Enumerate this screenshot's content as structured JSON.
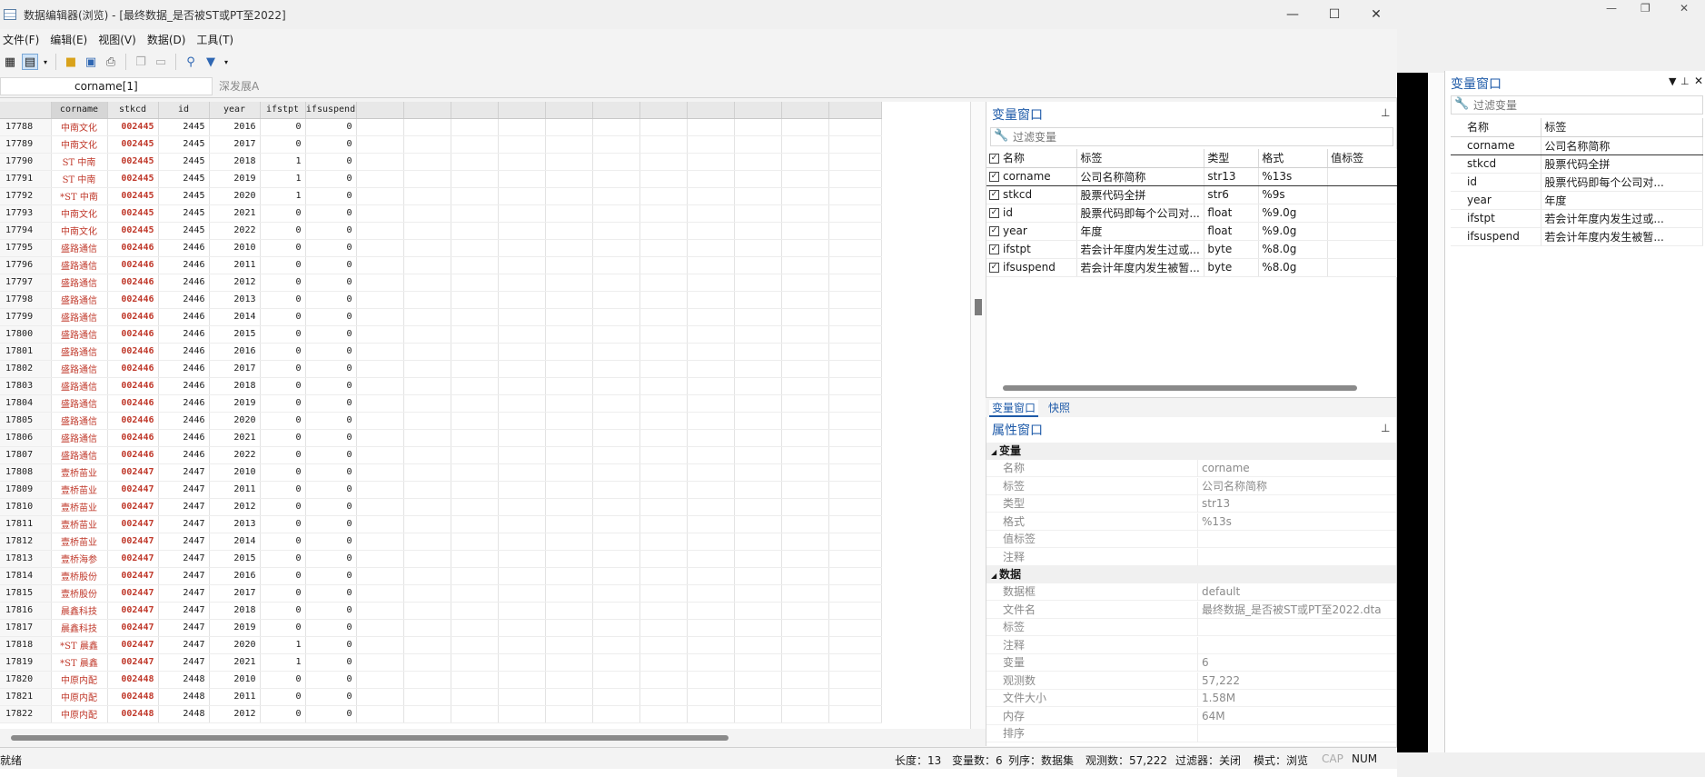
{
  "window": {
    "title": "数据编辑器(浏览) - [最终数据_是否被ST或PT至2022]",
    "minimize": "—",
    "maximize": "☐",
    "close": "✕"
  },
  "menu": [
    "文件(F)",
    "编辑(E)",
    "视图(V)",
    "数据(D)",
    "工具(T)"
  ],
  "cell_bar": {
    "reference": "corname[1]",
    "value": "深发展A"
  },
  "grid": {
    "columns": [
      "corname",
      "stkcd",
      "id",
      "year",
      "ifstpt",
      "ifsuspend"
    ],
    "rows": [
      [
        "17788",
        "中南文化",
        "002445",
        "2445",
        "2016",
        "0",
        "0"
      ],
      [
        "17789",
        "中南文化",
        "002445",
        "2445",
        "2017",
        "0",
        "0"
      ],
      [
        "17790",
        "ST 中南",
        "002445",
        "2445",
        "2018",
        "1",
        "0"
      ],
      [
        "17791",
        "ST 中南",
        "002445",
        "2445",
        "2019",
        "1",
        "0"
      ],
      [
        "17792",
        "*ST 中南",
        "002445",
        "2445",
        "2020",
        "1",
        "0"
      ],
      [
        "17793",
        "中南文化",
        "002445",
        "2445",
        "2021",
        "0",
        "0"
      ],
      [
        "17794",
        "中南文化",
        "002445",
        "2445",
        "2022",
        "0",
        "0"
      ],
      [
        "17795",
        "盛路通信",
        "002446",
        "2446",
        "2010",
        "0",
        "0"
      ],
      [
        "17796",
        "盛路通信",
        "002446",
        "2446",
        "2011",
        "0",
        "0"
      ],
      [
        "17797",
        "盛路通信",
        "002446",
        "2446",
        "2012",
        "0",
        "0"
      ],
      [
        "17798",
        "盛路通信",
        "002446",
        "2446",
        "2013",
        "0",
        "0"
      ],
      [
        "17799",
        "盛路通信",
        "002446",
        "2446",
        "2014",
        "0",
        "0"
      ],
      [
        "17800",
        "盛路通信",
        "002446",
        "2446",
        "2015",
        "0",
        "0"
      ],
      [
        "17801",
        "盛路通信",
        "002446",
        "2446",
        "2016",
        "0",
        "0"
      ],
      [
        "17802",
        "盛路通信",
        "002446",
        "2446",
        "2017",
        "0",
        "0"
      ],
      [
        "17803",
        "盛路通信",
        "002446",
        "2446",
        "2018",
        "0",
        "0"
      ],
      [
        "17804",
        "盛路通信",
        "002446",
        "2446",
        "2019",
        "0",
        "0"
      ],
      [
        "17805",
        "盛路通信",
        "002446",
        "2446",
        "2020",
        "0",
        "0"
      ],
      [
        "17806",
        "盛路通信",
        "002446",
        "2446",
        "2021",
        "0",
        "0"
      ],
      [
        "17807",
        "盛路通信",
        "002446",
        "2446",
        "2022",
        "0",
        "0"
      ],
      [
        "17808",
        "壹桥苗业",
        "002447",
        "2447",
        "2010",
        "0",
        "0"
      ],
      [
        "17809",
        "壹桥苗业",
        "002447",
        "2447",
        "2011",
        "0",
        "0"
      ],
      [
        "17810",
        "壹桥苗业",
        "002447",
        "2447",
        "2012",
        "0",
        "0"
      ],
      [
        "17811",
        "壹桥苗业",
        "002447",
        "2447",
        "2013",
        "0",
        "0"
      ],
      [
        "17812",
        "壹桥苗业",
        "002447",
        "2447",
        "2014",
        "0",
        "0"
      ],
      [
        "17813",
        "壹桥海参",
        "002447",
        "2447",
        "2015",
        "0",
        "0"
      ],
      [
        "17814",
        "壹桥股份",
        "002447",
        "2447",
        "2016",
        "0",
        "0"
      ],
      [
        "17815",
        "壹桥股份",
        "002447",
        "2447",
        "2017",
        "0",
        "0"
      ],
      [
        "17816",
        "晨鑫科技",
        "002447",
        "2447",
        "2018",
        "0",
        "0"
      ],
      [
        "17817",
        "晨鑫科技",
        "002447",
        "2447",
        "2019",
        "0",
        "0"
      ],
      [
        "17818",
        "*ST 晨鑫",
        "002447",
        "2447",
        "2020",
        "1",
        "0"
      ],
      [
        "17819",
        "*ST 晨鑫",
        "002447",
        "2447",
        "2021",
        "1",
        "0"
      ],
      [
        "17820",
        "中原内配",
        "002448",
        "2448",
        "2010",
        "0",
        "0"
      ],
      [
        "17821",
        "中原内配",
        "002448",
        "2448",
        "2011",
        "0",
        "0"
      ],
      [
        "17822",
        "中原内配",
        "002448",
        "2448",
        "2012",
        "0",
        "0"
      ]
    ]
  },
  "variables_pane": {
    "title": "变量窗口",
    "filter_placeholder": "过滤变量",
    "headers": [
      "名称",
      "标签",
      "类型",
      "格式",
      "值标签"
    ],
    "rows": [
      [
        "corname",
        "公司名称简称",
        "str13",
        "%13s",
        ""
      ],
      [
        "stkcd",
        "股票代码全拼",
        "str6",
        "%9s",
        ""
      ],
      [
        "id",
        "股票代码即每个公司对...",
        "float",
        "%9.0g",
        ""
      ],
      [
        "year",
        "年度",
        "float",
        "%9.0g",
        ""
      ],
      [
        "ifstpt",
        "若会计年度内发生过或...",
        "byte",
        "%8.0g",
        ""
      ],
      [
        "ifsuspend",
        "若会计年度内发生被暂...",
        "byte",
        "%8.0g",
        ""
      ]
    ],
    "tabs": [
      "变量窗口",
      "快照"
    ]
  },
  "properties_pane": {
    "title": "属性窗口",
    "groups": [
      {
        "name": "变量",
        "rows": [
          [
            "名称",
            "corname"
          ],
          [
            "标签",
            "公司名称简称"
          ],
          [
            "类型",
            "str13"
          ],
          [
            "格式",
            "%13s"
          ],
          [
            "值标签",
            ""
          ],
          [
            "注释",
            ""
          ]
        ]
      },
      {
        "name": "数据",
        "rows": [
          [
            "数据框",
            "default"
          ],
          [
            "文件名",
            "最终数据_是否被ST或PT至2022.dta"
          ],
          [
            "标签",
            ""
          ],
          [
            "注释",
            ""
          ],
          [
            "变量",
            "6"
          ],
          [
            "观测数",
            "57,222"
          ],
          [
            "文件大小",
            "1.58M"
          ],
          [
            "内存",
            "64M"
          ],
          [
            "排序",
            ""
          ]
        ]
      }
    ]
  },
  "status_bar": {
    "ready": "就绪",
    "length": "长度：13",
    "vars": "变量数：6",
    "order": "列序：数据集",
    "obs": "观测数：57,222",
    "filter": "过滤器：关闭",
    "mode": "模式：浏览",
    "cap": "CAP",
    "num": "NUM"
  },
  "main_varwin": {
    "title": "变量窗口",
    "filter_placeholder": "过滤变量",
    "headers": [
      "名称",
      "标签"
    ],
    "rows": [
      [
        "corname",
        "公司名称简称"
      ],
      [
        "stkcd",
        "股票代码全拼"
      ],
      [
        "id",
        "股票代码即每个公司对..."
      ],
      [
        "year",
        "年度"
      ],
      [
        "ifstpt",
        "若会计年度内发生过或..."
      ],
      [
        "ifsuspend",
        "若会计年度内发生被暂..."
      ]
    ]
  },
  "colors": {
    "accent": "#1e5aa8",
    "string_cell": "#c0392b"
  }
}
